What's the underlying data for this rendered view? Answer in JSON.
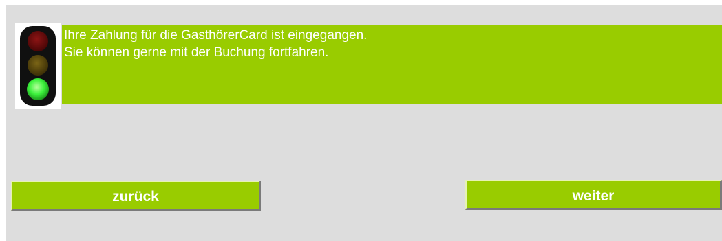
{
  "status": {
    "traffic_light_state": "green",
    "colors": {
      "red_off": "#6b0a0a",
      "yellow_off": "#5a4a0c",
      "green_on": "#3df23d",
      "housing": "#101010"
    },
    "message_lines": [
      "Ihre Zahlung für die GasthörerCard ist eingegangen.",
      "Sie können gerne mit der Buchung fortfahren."
    ]
  },
  "navigation": {
    "back_label": "zurück",
    "next_label": "weiter"
  },
  "theme": {
    "accent": "#99cc00",
    "background": "#dddddd",
    "text_on_accent": "#ffffff"
  }
}
